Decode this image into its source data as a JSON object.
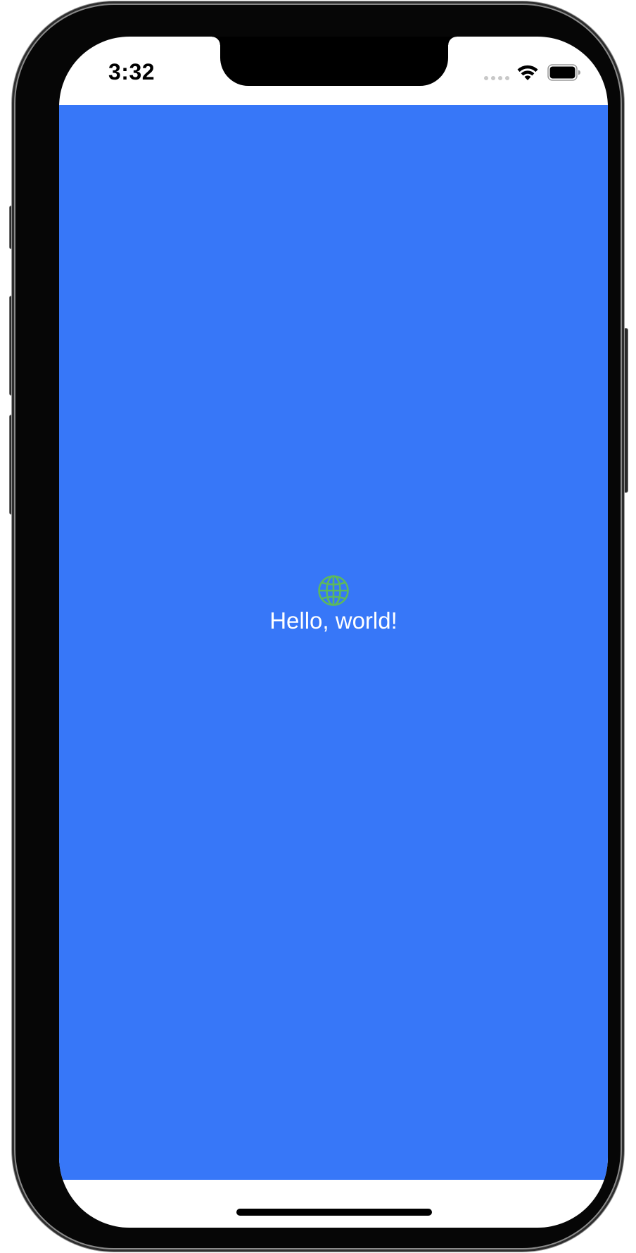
{
  "status_bar": {
    "time": "3:32",
    "signal_icon": "cellular-signal-dots-icon",
    "wifi_icon": "wifi-icon",
    "battery_icon": "battery-full-icon"
  },
  "main": {
    "background_color": "#3777f8",
    "icon": "globe-icon",
    "icon_color": "#5db85e",
    "text": "Hello, world!",
    "text_color": "#ffffff"
  },
  "device": {
    "frame_color": "#060606"
  }
}
